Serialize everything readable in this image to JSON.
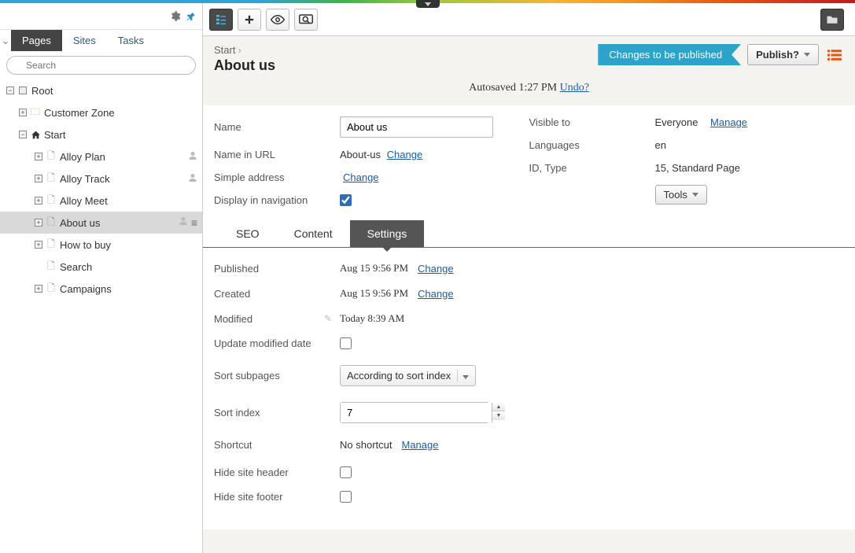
{
  "sidebar": {
    "tabs": [
      "Pages",
      "Sites",
      "Tasks"
    ],
    "search_placeholder": "Search",
    "tree": {
      "root": "Root",
      "customer_zone": "Customer Zone",
      "start": "Start",
      "children": [
        {
          "label": "Alloy Plan",
          "has_user": true
        },
        {
          "label": "Alloy Track",
          "has_user": true
        },
        {
          "label": "Alloy Meet",
          "has_user": false
        },
        {
          "label": "About us",
          "has_user": true,
          "selected": true
        },
        {
          "label": "How to buy",
          "has_user": false
        },
        {
          "label": "Search",
          "has_user": false,
          "leaf": true
        },
        {
          "label": "Campaigns",
          "has_user": false
        }
      ]
    }
  },
  "header": {
    "breadcrumb": "Start",
    "title": "About us",
    "status": "Changes to be published",
    "publish_label": "Publish?",
    "autosave_prefix": "Autosaved",
    "autosave_time": "1:27 PM",
    "undo": "Undo?"
  },
  "form": {
    "name_label": "Name",
    "name_value": "About us",
    "url_label": "Name in URL",
    "url_value": "About-us",
    "simple_label": "Simple address",
    "display_nav_label": "Display in navigation",
    "change": "Change",
    "visible_label": "Visible to",
    "visible_value": "Everyone",
    "manage": "Manage",
    "lang_label": "Languages",
    "lang_value": "en",
    "id_label": "ID, Type",
    "id_value": "15, Standard Page",
    "tools": "Tools"
  },
  "content_tabs": [
    "SEO",
    "Content",
    "Settings"
  ],
  "settings": {
    "published_label": "Published",
    "published_value": "Aug 15 9:56 PM",
    "created_label": "Created",
    "created_value": "Aug 15 9:56 PM",
    "modified_label": "Modified",
    "modified_value": "Today 8:39 AM",
    "update_mod_label": "Update modified date",
    "sort_subpages_label": "Sort subpages",
    "sort_subpages_value": "According to sort index",
    "sort_index_label": "Sort index",
    "sort_index_value": "7",
    "shortcut_label": "Shortcut",
    "shortcut_value": "No shortcut",
    "hide_header_label": "Hide site header",
    "hide_footer_label": "Hide site footer",
    "change": "Change",
    "manage": "Manage"
  }
}
